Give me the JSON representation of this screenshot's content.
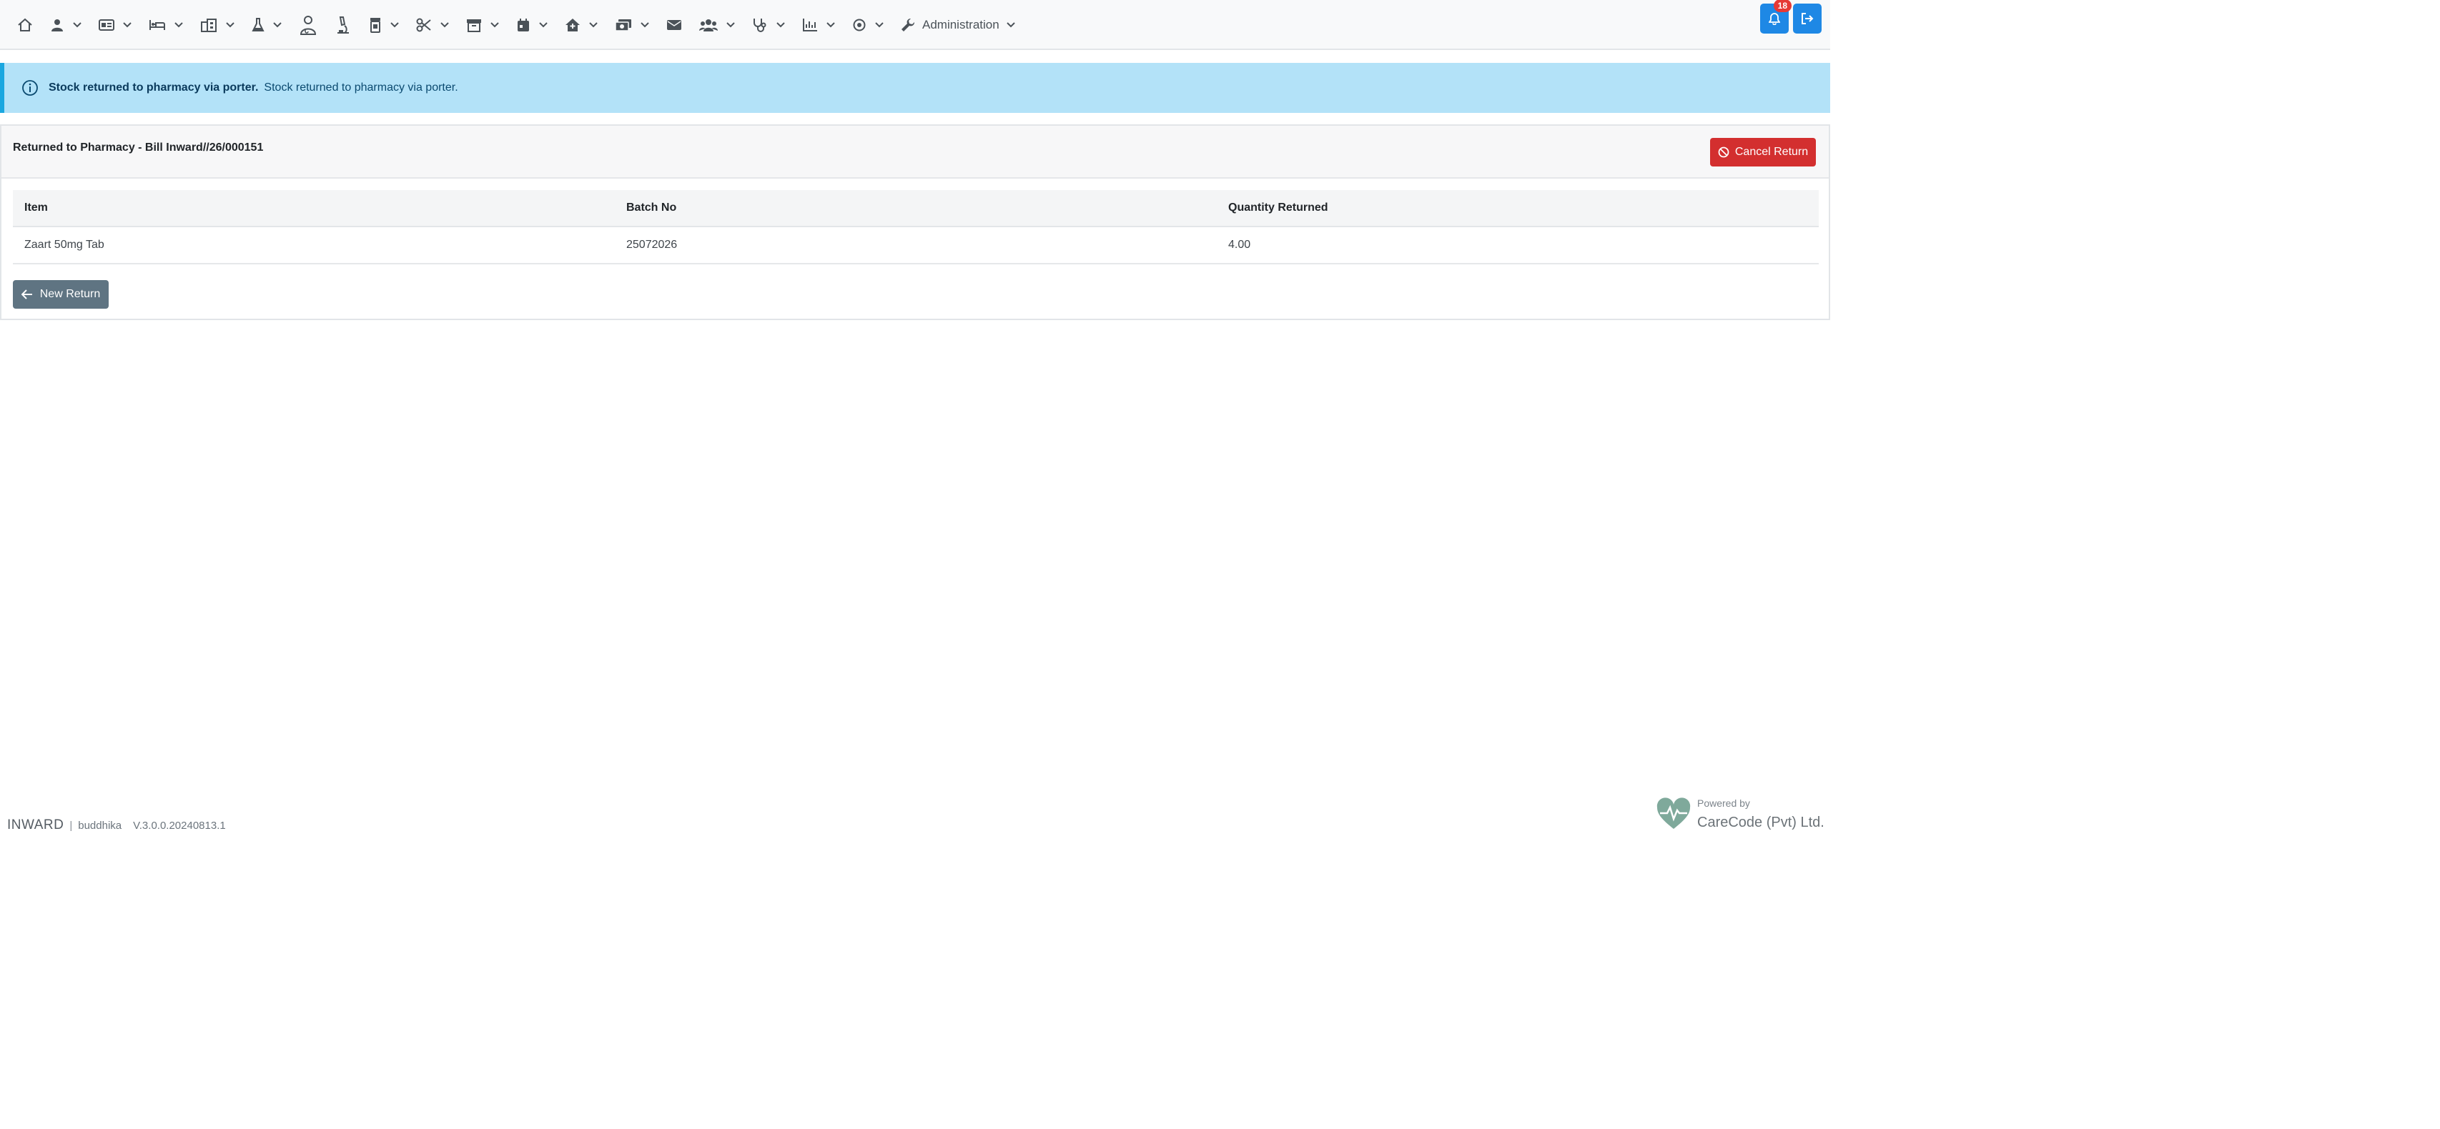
{
  "navbar": {
    "admin_label": "Administration",
    "notification_count": "18"
  },
  "alert": {
    "summary": "Stock returned to pharmacy via porter.",
    "detail": "Stock returned to pharmacy via porter."
  },
  "card": {
    "title": "Returned to Pharmacy - Bill Inward//26/000151",
    "cancel_label": "Cancel Return",
    "new_return_label": "New Return"
  },
  "table": {
    "columns": [
      "Item",
      "Batch No",
      "Quantity Returned"
    ],
    "rows": [
      [
        "Zaart 50mg Tab",
        "25072026",
        "4.00"
      ]
    ]
  },
  "footer": {
    "department": "INWARD",
    "separator": "|",
    "user": "buddhika",
    "version": "V.3.0.0.20240813.1",
    "powered_by": "Powered by",
    "company": "CareCode (Pvt) Ltd."
  },
  "colors": {
    "primary": "#1e88e5",
    "danger": "#d32f2f",
    "secondary": "#5f7482",
    "info_bg": "#b3e2f8"
  }
}
